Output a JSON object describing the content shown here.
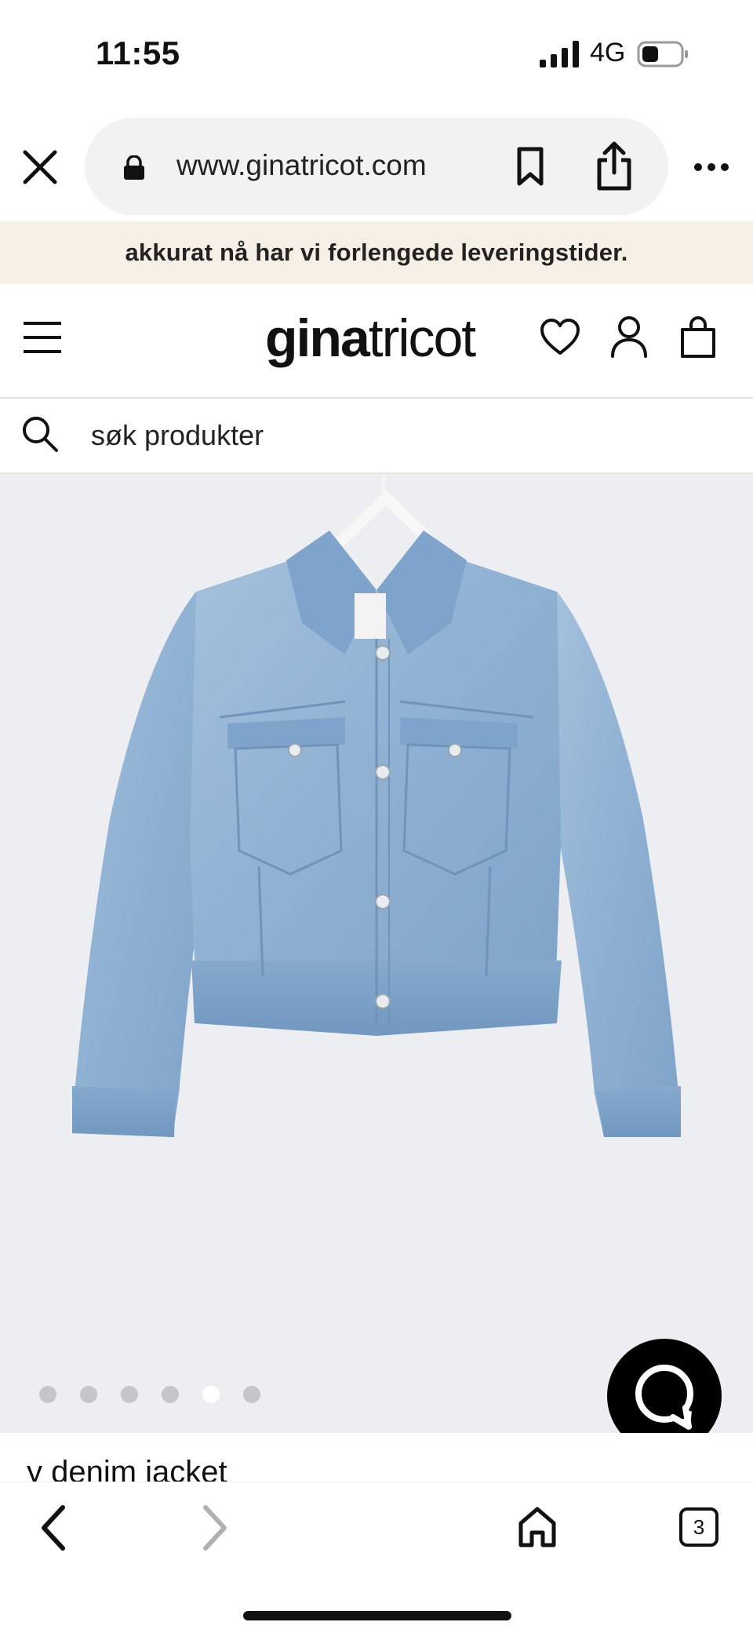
{
  "status_bar": {
    "time": "11:55",
    "network": "4G",
    "signal_icon": "cellular-signal-icon",
    "battery_icon": "battery-icon"
  },
  "browser": {
    "url": "www.ginatricot.com",
    "icons": [
      "close-icon",
      "lock-icon",
      "bookmark-icon",
      "share-icon",
      "more-icon"
    ]
  },
  "announcement": {
    "text": "akkurat nå har vi forlengede leveringstider."
  },
  "header": {
    "logo_bold": "gina",
    "logo_light": "tricot",
    "icons": [
      "menu-icon",
      "heart-icon",
      "user-icon",
      "bag-icon"
    ]
  },
  "search": {
    "placeholder": "søk produkter"
  },
  "product": {
    "image_dots_total": 6,
    "image_dots_active_index": 4,
    "title": "y denim jacket"
  },
  "toolbar": {
    "tab_count": "3",
    "icons": [
      "back-icon",
      "forward-icon",
      "home-icon",
      "tabs-icon"
    ]
  },
  "colors": {
    "announcement_bg": "#f5efe6",
    "image_bg": "#eceef1",
    "chat_button": "#000000",
    "denim": "#8fb2d4"
  }
}
